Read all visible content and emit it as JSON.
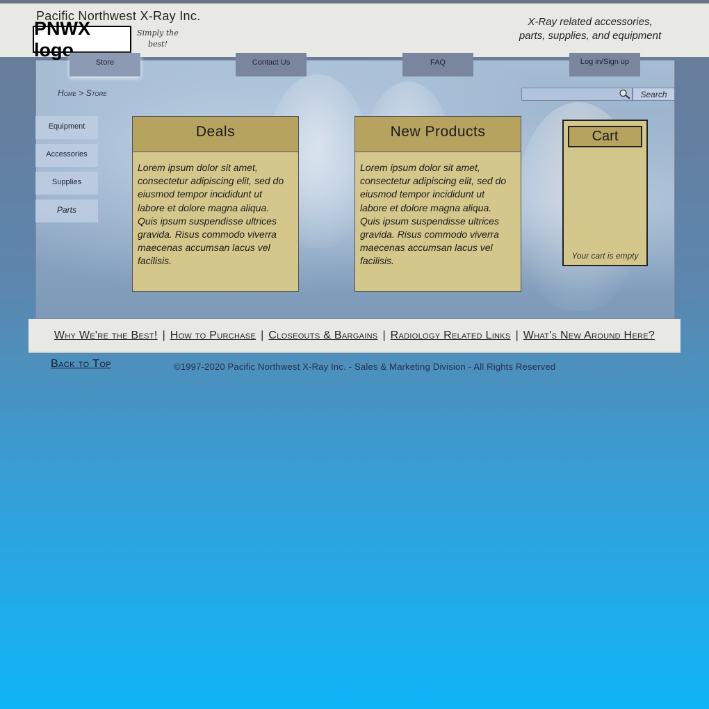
{
  "header": {
    "company_name": "Pacific Northwest X-Ray Inc.",
    "logo_text": "PNWX logo",
    "slogan": "Simply the best!",
    "tagline_line1": "X-Ray related accessories,",
    "tagline_line2": "parts, supplies, and equipment"
  },
  "nav": {
    "store": "Store",
    "contact": "Contact Us",
    "faq": "FAQ",
    "login": "Log in/Sign up"
  },
  "breadcrumb": {
    "home": "Home",
    "separator": ">",
    "current": "Store"
  },
  "search": {
    "placeholder": "",
    "button_label": "Search"
  },
  "sidebar": {
    "items": [
      {
        "label": "Equipment"
      },
      {
        "label": "Accessories"
      },
      {
        "label": "Supplies"
      },
      {
        "label": "Parts"
      }
    ]
  },
  "panels": {
    "deals": {
      "title": "Deals",
      "body": "Lorem ipsum dolor sit amet, consectetur adipiscing elit, sed do eiusmod tempor incididunt ut labore et dolore magna aliqua. Quis ipsum suspendisse ultrices gravida. Risus commodo viverra maecenas accumsan lacus vel facilisis."
    },
    "new_products": {
      "title": "New Products",
      "body": "Lorem ipsum dolor sit amet, consectetur adipiscing elit, sed do eiusmod tempor incididunt ut labore et dolore magna aliqua. Quis ipsum suspendisse ultrices gravida. Risus commodo viverra maecenas accumsan lacus vel facilisis."
    }
  },
  "cart": {
    "title": "Cart",
    "empty_text": "Your cart is empty"
  },
  "footer": {
    "links": [
      "Why We're the Best!",
      "How to Purchase",
      "Closeouts & Bargains",
      "Radiology Related Links",
      "What's New Around Here?"
    ],
    "separator": "|",
    "back_to_top": "Back to Top",
    "copyright": "©1997-2020 Pacific Northwest X-Ray Inc. - Sales & Marketing Division - All Rights Reserved"
  },
  "colors": {
    "panel_header": "#b6a35f",
    "panel_body": "#d4c78b",
    "nav_button": "#7a869e"
  }
}
